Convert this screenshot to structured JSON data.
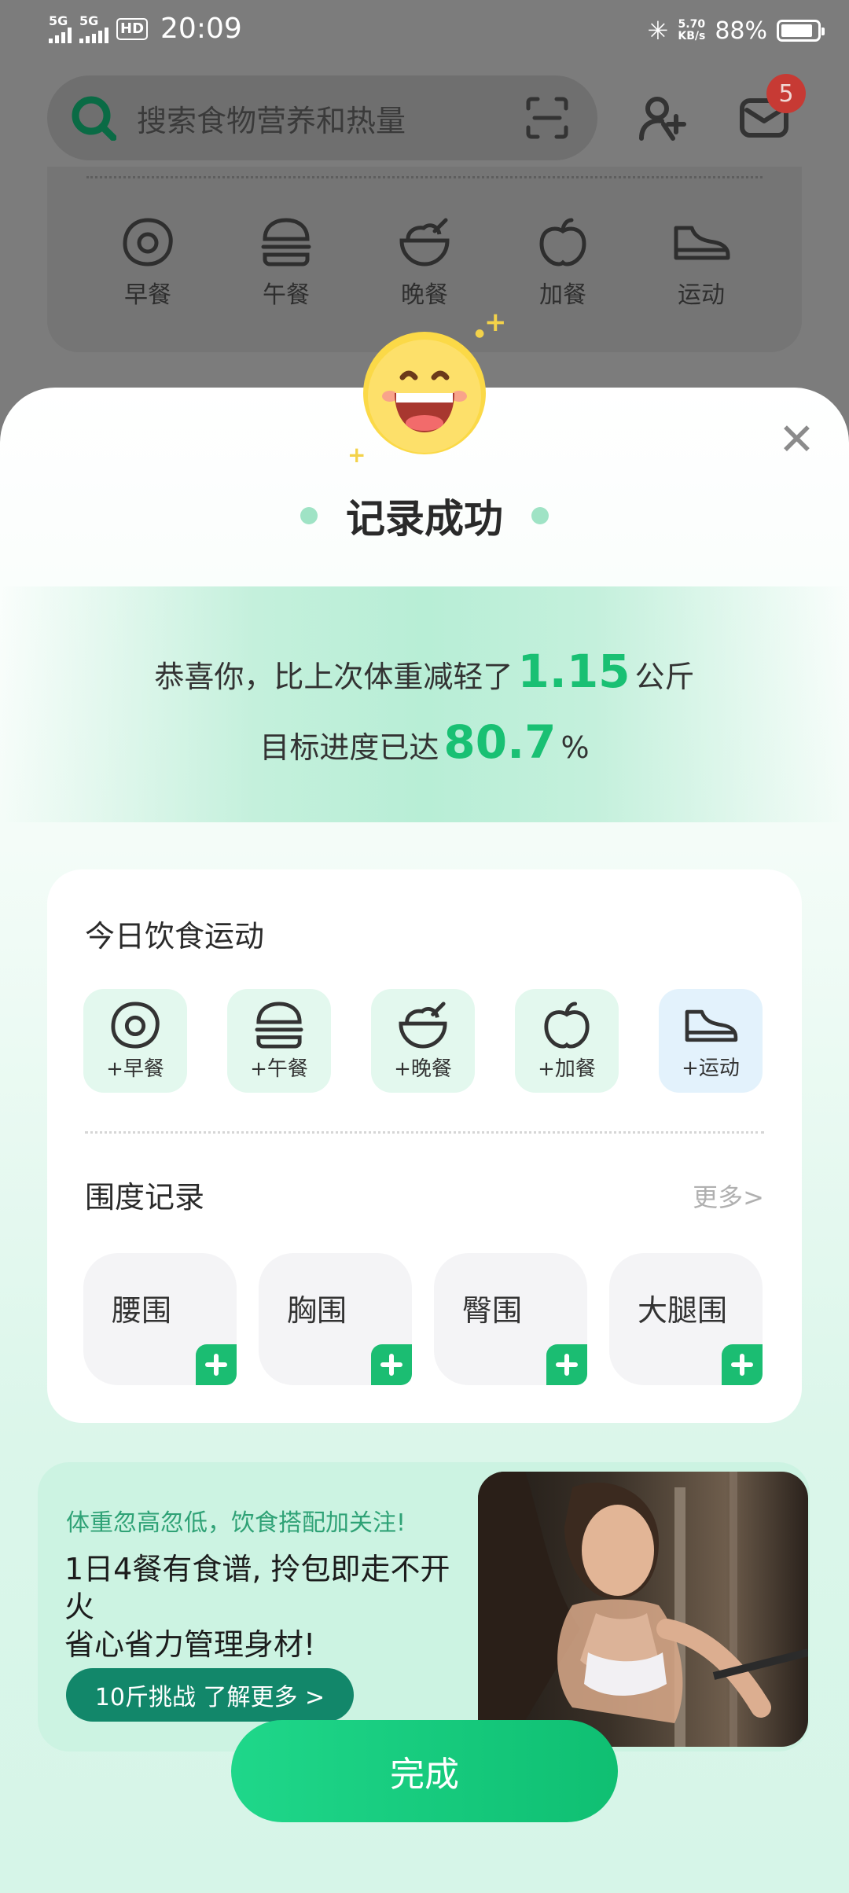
{
  "status_bar": {
    "network1": "5G",
    "network2": "5G",
    "hd": "HD",
    "time": "20:09",
    "speed_value": "5.70",
    "speed_unit": "KB/s",
    "battery": "88%",
    "battery_level": 0.88
  },
  "header": {
    "search_placeholder": "搜索食物营养和热量",
    "mail_badge": "5"
  },
  "bg_meals": [
    "早餐",
    "午餐",
    "晚餐",
    "加餐",
    "运动"
  ],
  "modal": {
    "title": "记录成功",
    "msg_prefix": "恭喜你，比上次体重减轻了",
    "weight_loss": "1.15",
    "weight_unit": "公斤",
    "progress_prefix": "目标进度已达",
    "progress_value": "80.7",
    "progress_unit": "%"
  },
  "diet_card": {
    "title": "今日饮食运动",
    "items": [
      "+早餐",
      "+午餐",
      "+晚餐",
      "+加餐",
      "+运动"
    ]
  },
  "girth": {
    "title": "围度记录",
    "more": "更多>",
    "items": [
      "腰围",
      "胸围",
      "臀围",
      "大腿围"
    ]
  },
  "promo": {
    "subtitle": "体重忽高忽低，饮食搭配加关注!",
    "line1": "1日4餐有食谱, 拎包即走不开火",
    "line2": "省心省力管理身材!",
    "button": "10斤挑战 了解更多 >"
  },
  "done_button": "完成",
  "colors": {
    "accent": "#19c073",
    "brand_dark": "#12876a",
    "plus_green": "#1bbd72"
  }
}
